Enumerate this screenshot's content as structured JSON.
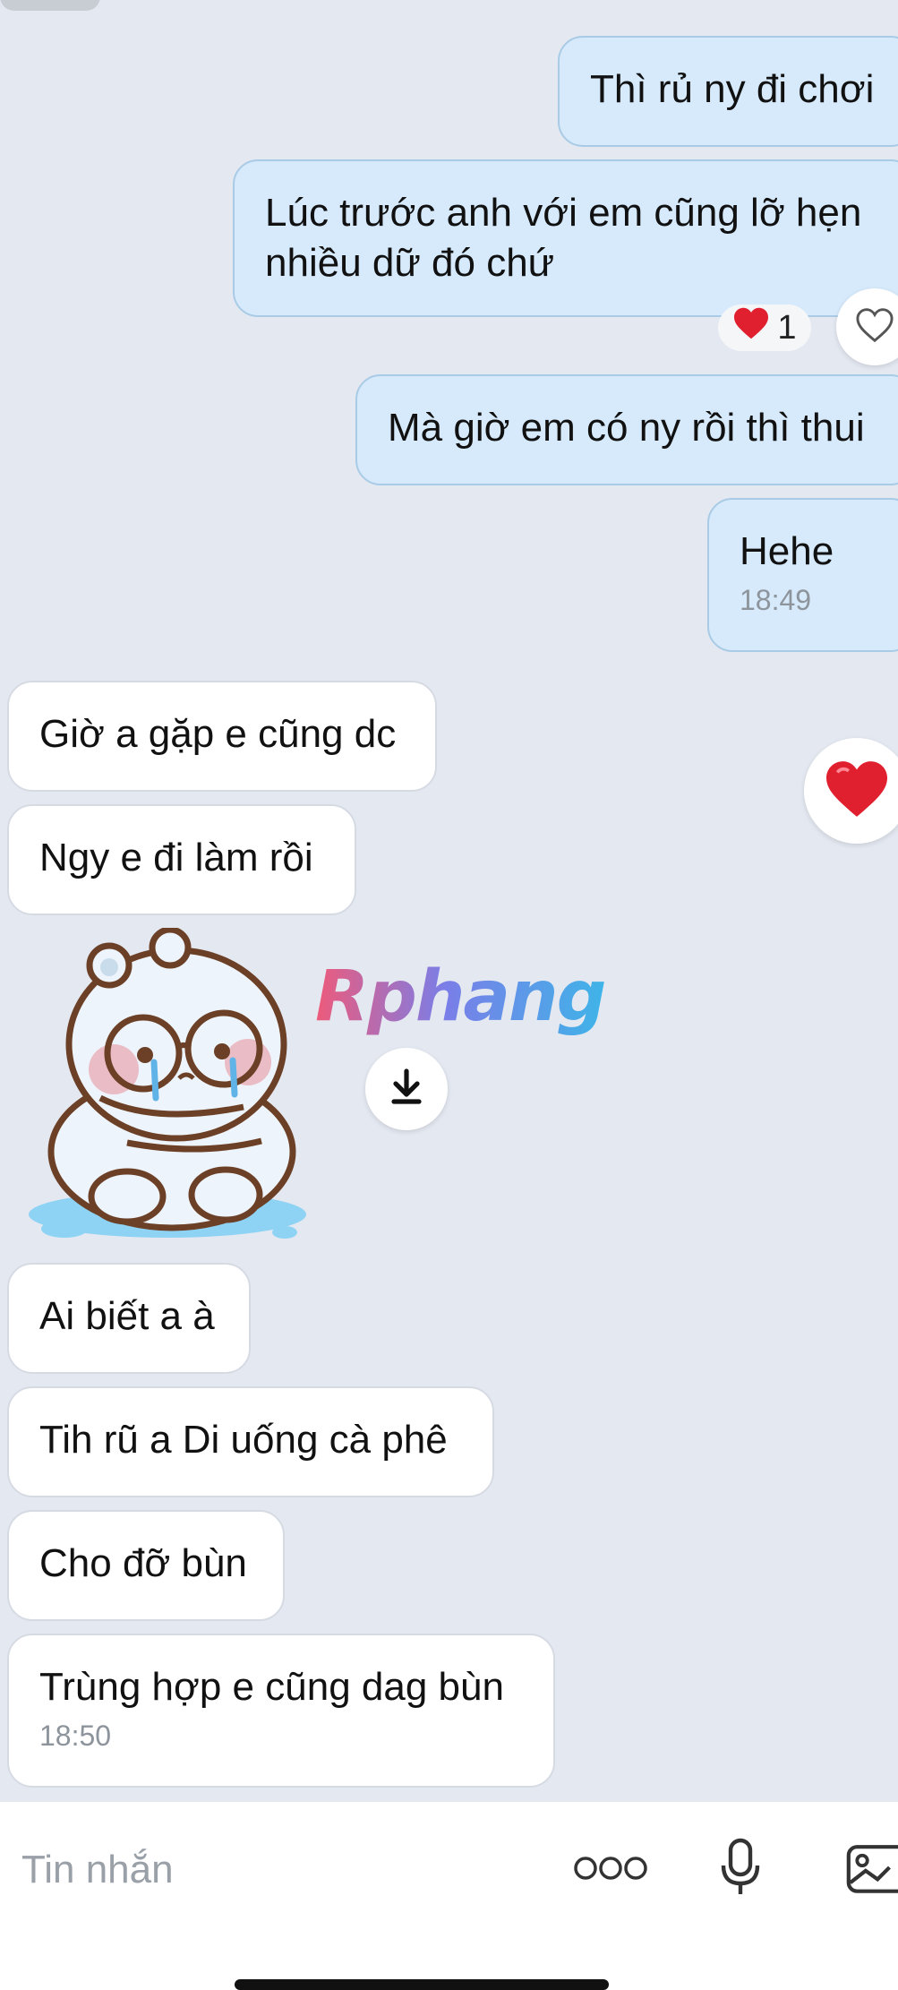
{
  "chat": {
    "messages": [
      {
        "side": "out",
        "text": "Thì rủ ny đi chơi"
      },
      {
        "side": "out",
        "text": "Lúc trước anh với em cũng lỡ hẹn nhiều dữ đó chứ",
        "reaction": {
          "emoji": "heart",
          "count": "1"
        }
      },
      {
        "side": "out",
        "text": "Mà giờ em có ny rồi thì thui"
      },
      {
        "side": "out",
        "text": "Hehe",
        "time": "18:49"
      },
      {
        "side": "in",
        "text": "Giờ a gặp e cũng dc"
      },
      {
        "side": "in",
        "text": "Ngy e đi làm rồi"
      },
      {
        "side": "in",
        "type": "sticker",
        "sticker": "crying-bear-sticker"
      },
      {
        "side": "in",
        "text": "Ai biết a à"
      },
      {
        "side": "in",
        "text": "Tih rũ a Di uống cà phê"
      },
      {
        "side": "in",
        "text": "Cho đỡ bùn"
      },
      {
        "side": "in",
        "text": "Trùng hợp e cũng dag bùn",
        "time": "18:50"
      }
    ]
  },
  "watermark": "Rphang",
  "composer": {
    "placeholder": "Tin nhắn",
    "icons": [
      "more-icon",
      "microphone-icon",
      "image-icon"
    ]
  },
  "colors": {
    "background": "#e4e8f1",
    "outgoing_bubble": "#d6eafb",
    "incoming_bubble": "#ffffff",
    "heart": "#e0202f"
  }
}
